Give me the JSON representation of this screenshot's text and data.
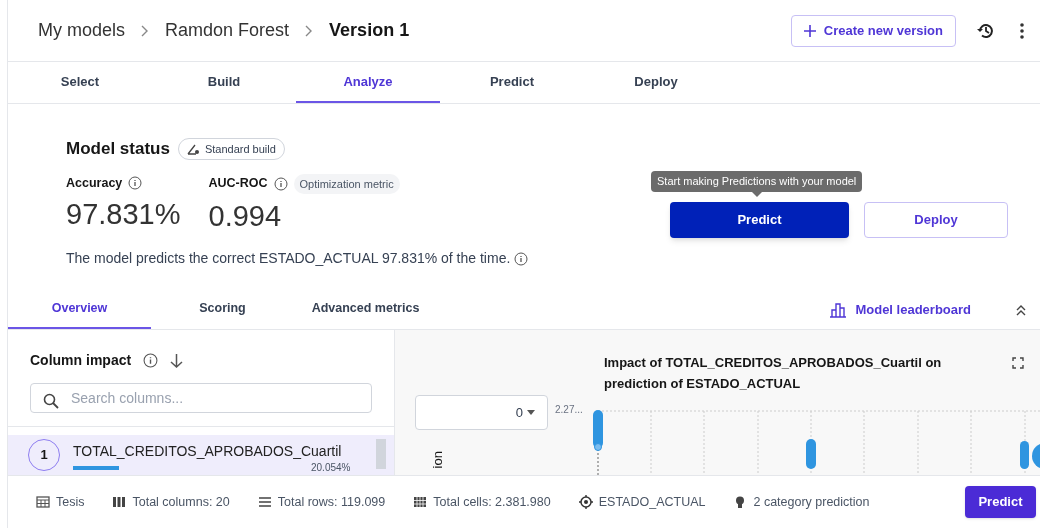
{
  "breadcrumb": [
    {
      "label": "My models",
      "current": false
    },
    {
      "label": "Ramdon Forest",
      "current": false
    },
    {
      "label": "Version 1",
      "current": true
    }
  ],
  "header_actions": {
    "create_button": "Create new version"
  },
  "tabs": [
    {
      "label": "Select",
      "selected": false
    },
    {
      "label": "Build",
      "selected": false
    },
    {
      "label": "Analyze",
      "selected": true
    },
    {
      "label": "Predict",
      "selected": false
    },
    {
      "label": "Deploy",
      "selected": false
    }
  ],
  "model_status": {
    "title": "Model status",
    "build_badge": "Standard build",
    "metrics": [
      {
        "label": "Accuracy",
        "value": "97.831%"
      },
      {
        "label": "AUC-ROC",
        "value": "0.994",
        "tag": "Optimization metric"
      }
    ],
    "description": "The model predicts the correct ESTADO_ACTUAL 97.831% of the time.",
    "tooltip": "Start making Predictions with your model",
    "predict_button": "Predict",
    "deploy_button": "Deploy"
  },
  "sub_tabs": [
    {
      "label": "Overview",
      "selected": true
    },
    {
      "label": "Scoring",
      "selected": false
    },
    {
      "label": "Advanced metrics",
      "selected": false
    }
  ],
  "leaderboard_link": "Model leaderboard",
  "column_impact": {
    "title": "Column impact",
    "search": {
      "placeholder": "Search columns..."
    },
    "items": [
      {
        "rank": "1",
        "name": "TOTAL_CREDITOS_APROBADOS_Cuartil",
        "level": 0.2,
        "percent": "20.054%",
        "selected": true
      }
    ]
  },
  "chart": {
    "title": "Impact of TOTAL_CREDITOS_APROBADOS_Cuartil on prediction of ESTADO_ACTUAL",
    "dropdown_value": "0",
    "y_tick": "2.27...",
    "y_label": "ion"
  },
  "status_bar": {
    "items": [
      {
        "kind": "table",
        "text": "Tesis"
      },
      {
        "kind": "columns",
        "text": "Total columns: 20"
      },
      {
        "kind": "rows",
        "text": "Total rows: 119.099"
      },
      {
        "kind": "cells",
        "text": "Total cells: 2.381.980"
      },
      {
        "kind": "target",
        "text": "ESTADO_ACTUAL"
      },
      {
        "kind": "bulb",
        "text": "2 category prediction"
      }
    ],
    "predict_button": "Predict"
  }
}
